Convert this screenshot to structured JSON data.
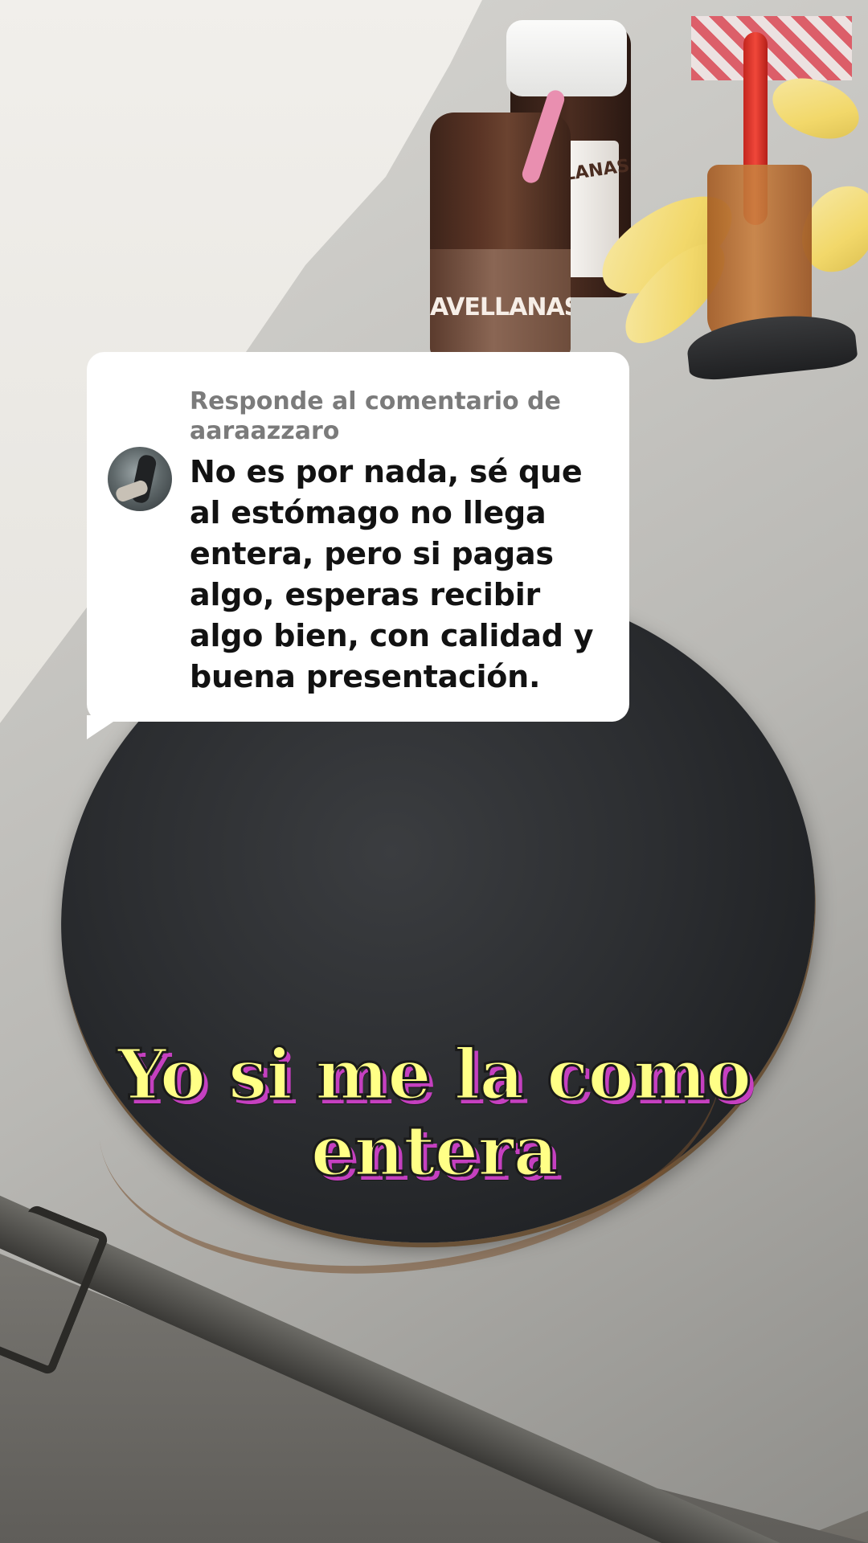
{
  "reply": {
    "header_prefix": "Responde al comentario de",
    "username": "aaraazzaro",
    "comment": "No es por nada, sé que al estómago no llega entera, pero si pagas algo, esperas recibir algo bien, con calidad y buena presentación."
  },
  "caption": {
    "line1": "Yo si me la como",
    "line2": "entera"
  },
  "scene": {
    "jar_label": "AVELLANAS",
    "jar2_label": "AVELLANAS"
  },
  "colors": {
    "caption_fill": "#ffff86",
    "caption_shadow": "#c540c0",
    "card_bg": "#ffffff",
    "header_text": "#7b7b7b",
    "comment_text": "#121212"
  }
}
